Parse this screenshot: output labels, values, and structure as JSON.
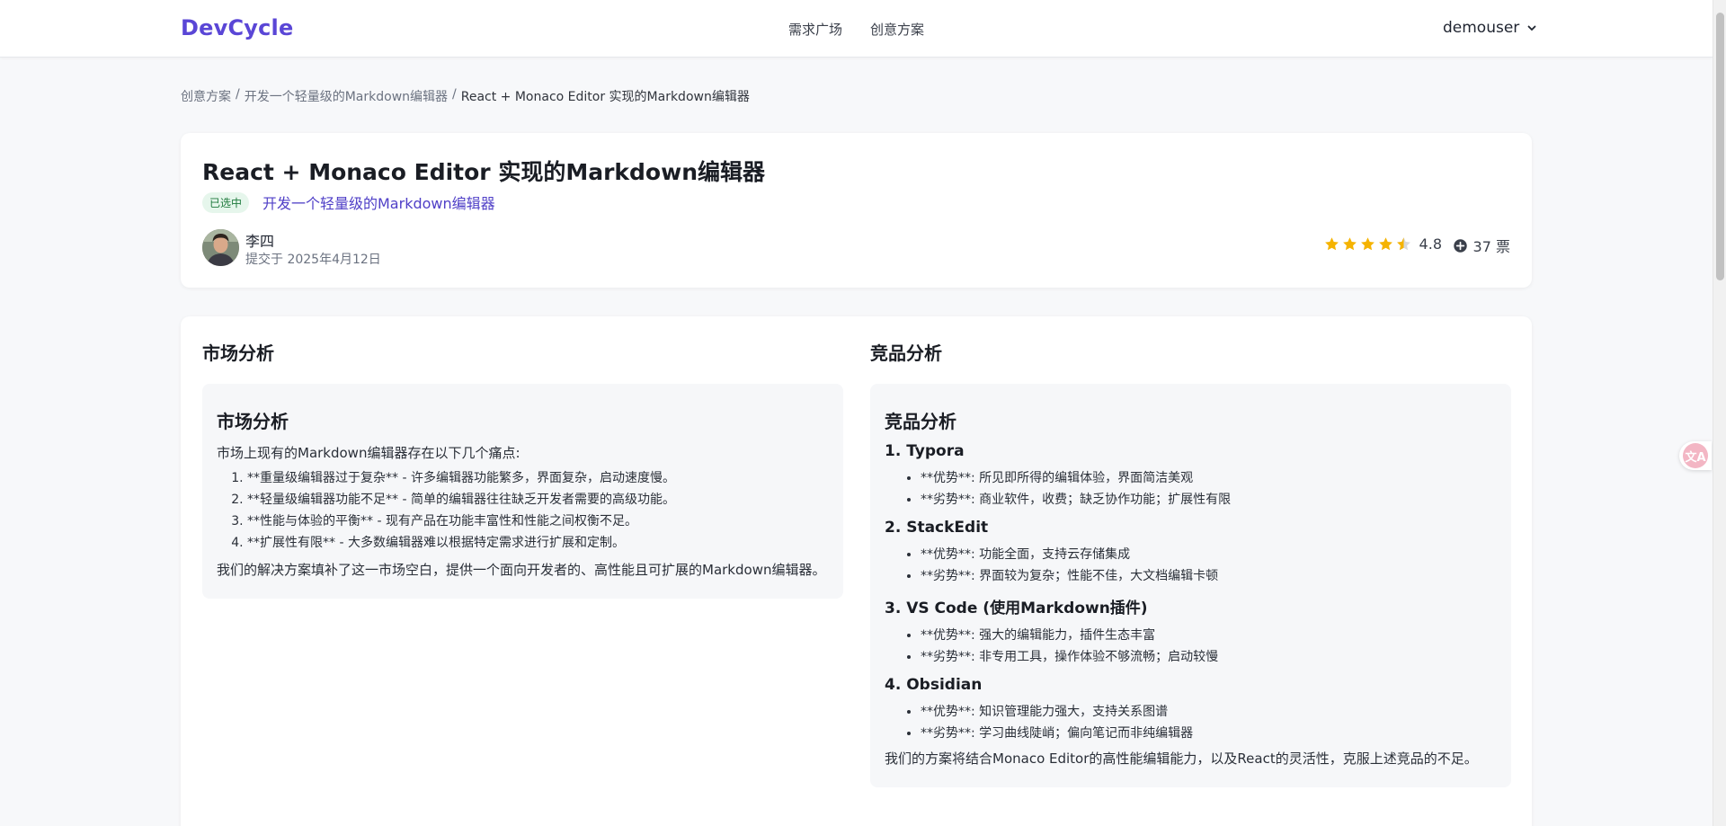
{
  "app": {
    "logo": "DevCycle"
  },
  "nav": {
    "items": [
      "需求广场",
      "创意方案"
    ]
  },
  "user": {
    "name": "demouser",
    "icon": "chevron-down-icon"
  },
  "breadcrumb": {
    "items": [
      "创意方案",
      "开发一个轻量级的Markdown编辑器",
      "React + Monaco Editor 实现的Markdown编辑器"
    ],
    "separator": "/"
  },
  "proposal": {
    "title": "React + Monaco Editor 实现的Markdown编辑器",
    "status": "已选中",
    "parent": "开发一个轻量级的Markdown编辑器",
    "author": "李四",
    "submitted": "提交于 2025年4月12日",
    "rating": "4.8",
    "rating_stars": 4.5,
    "votes": "37 票"
  },
  "market": {
    "column_title": "市场分析",
    "heading": "市场分析",
    "intro": "市场上现有的Markdown编辑器存在以下几个痛点:",
    "points": [
      "**重量级编辑器过于复杂** - 许多编辑器功能繁多，界面复杂，启动速度慢。",
      "**轻量级编辑器功能不足** - 简单的编辑器往往缺乏开发者需要的高级功能。",
      "**性能与体验的平衡** - 现有产品在功能丰富性和性能之间权衡不足。",
      "**扩展性有限** - 大多数编辑器难以根据特定需求进行扩展和定制。"
    ],
    "conclusion": "我们的解决方案填补了这一市场空白，提供一个面向开发者的、高性能且可扩展的Markdown编辑器。"
  },
  "competitors": {
    "column_title": "竞品分析",
    "heading": "竞品分析",
    "items": [
      {
        "name": "1. Typora",
        "points": [
          "**优势**: 所见即所得的编辑体验，界面简洁美观",
          "**劣势**: 商业软件，收费；缺乏协作功能；扩展性有限"
        ]
      },
      {
        "name": "2. StackEdit",
        "points": [
          "**优势**: 功能全面，支持云存储集成",
          "**劣势**: 界面较为复杂；性能不佳，大文档编辑卡顿"
        ]
      },
      {
        "name": "3. VS Code (使用Markdown插件)",
        "points": [
          "**优势**: 强大的编辑能力，插件生态丰富",
          "**劣势**: 非专用工具，操作体验不够流畅；启动较慢"
        ]
      },
      {
        "name": "4. Obsidian",
        "points": [
          "**优势**: 知识管理能力强大，支持关系图谱",
          "**劣势**: 学习曲线陡峭；偏向笔记而非纯编辑器"
        ]
      }
    ],
    "conclusion": "我们的方案将结合Monaco Editor的高性能编辑能力，以及React的灵活性，克服上述竞品的不足。"
  },
  "colors": {
    "brand": "#5a46d6",
    "star": "#f5b301",
    "badge_bg": "#e6f6ec",
    "badge_text": "#1f7a3d"
  },
  "translate": {
    "icon": "translate-icon",
    "glyph": "文A"
  }
}
